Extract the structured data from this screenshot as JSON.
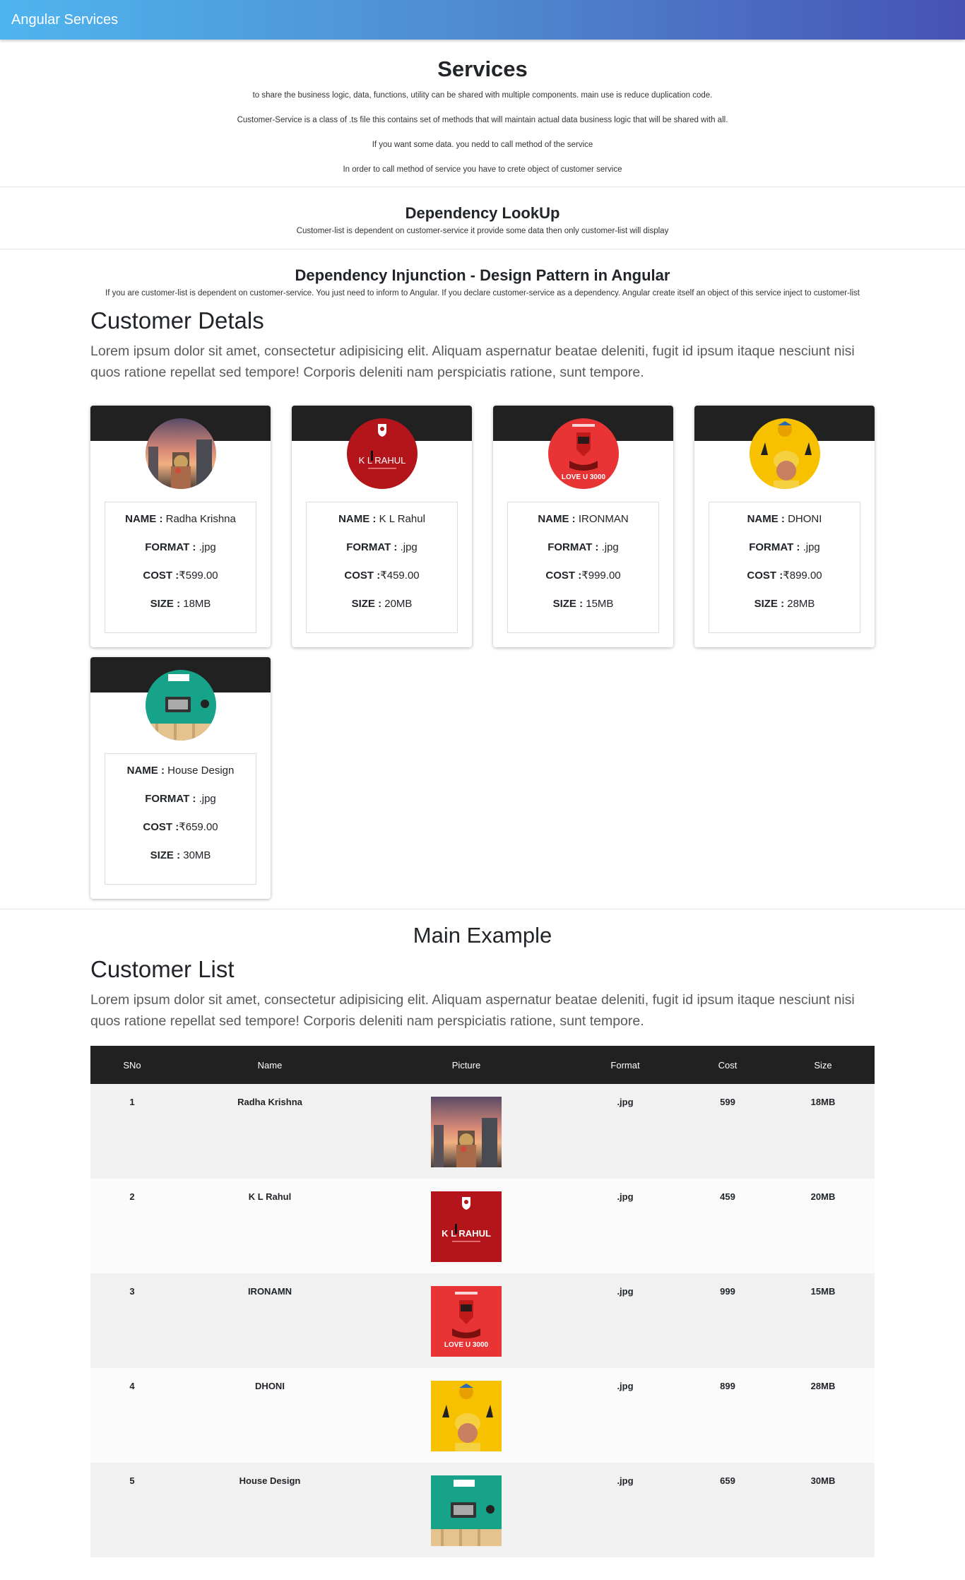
{
  "app": {
    "title": "Angular Services"
  },
  "services": {
    "heading": "Services",
    "lines": [
      "to share the business logic, data, functions, utility can be shared with multiple components. main use is reduce duplication code.",
      "Customer-Service is a class of .ts file this contains set of methods that will maintain actual data business logic that will be shared with all.",
      "If you want some data. you nedd to call method of the service",
      "In order to call method of service you have to crete object of customer service"
    ]
  },
  "lookup": {
    "heading": "Dependency LookUp",
    "text": "Customer-list is dependent on customer-service it provide some data then only customer-list will display"
  },
  "injection": {
    "heading": "Dependency Injunction - Design Pattern in Angular",
    "text": "If you are customer-list is dependent on customer-service. You just need to inform to Angular. If you declare customer-service as a dependency. Angular create itself an object of this service inject to customer-list"
  },
  "details": {
    "heading": "Customer Detals",
    "lead": "Lorem ipsum dolor sit amet, consectetur adipisicing elit. Aliquam aspernatur beatae deleniti, fugit id ipsum itaque nesciunt nisi quos ratione repellat sed tempore! Corporis deleniti nam perspiciatis ratione, sunt tempore.",
    "labels": {
      "name": "NAME :",
      "format": "FORMAT :",
      "cost": "COST :",
      "size": "SIZE :"
    },
    "cards": [
      {
        "name": "Radha Krishna",
        "format": ".jpg",
        "cost": "₹599.00",
        "size": "18MB",
        "image": "temple-sunset-image"
      },
      {
        "name": "K L Rahul",
        "format": ".jpg",
        "cost": "₹459.00",
        "size": "20MB",
        "image": "kl-rahul-poster-image"
      },
      {
        "name": "IRONMAN",
        "format": ".jpg",
        "cost": "₹999.00",
        "size": "15MB",
        "image": "ironman-love-poster-image"
      },
      {
        "name": "DHONI",
        "format": ".jpg",
        "cost": "₹899.00",
        "size": "28MB",
        "image": "dhoni-csk-poster-image"
      },
      {
        "name": "House Design",
        "format": ".jpg",
        "cost": "₹659.00",
        "size": "30MB",
        "image": "house-design-image"
      }
    ]
  },
  "main": {
    "heading": "Main Example",
    "list_heading": "Customer List",
    "lead": "Lorem ipsum dolor sit amet, consectetur adipisicing elit. Aliquam aspernatur beatae deleniti, fugit id ipsum itaque nesciunt nisi quos ratione repellat sed tempore! Corporis deleniti nam perspiciatis ratione, sunt tempore.",
    "table": {
      "headers": [
        "SNo",
        "Name",
        "Picture",
        "Format",
        "Cost",
        "Size"
      ],
      "rows": [
        {
          "sno": "1",
          "name": "Radha Krishna",
          "format": ".jpg",
          "cost": "599",
          "size": "18MB"
        },
        {
          "sno": "2",
          "name": "K L Rahul",
          "format": ".jpg",
          "cost": "459",
          "size": "20MB"
        },
        {
          "sno": "3",
          "name": "IRONAMN",
          "format": ".jpg",
          "cost": "999",
          "size": "15MB"
        },
        {
          "sno": "4",
          "name": "DHONI",
          "format": ".jpg",
          "cost": "899",
          "size": "28MB"
        },
        {
          "sno": "5",
          "name": "House Design",
          "format": ".jpg",
          "cost": "659",
          "size": "30MB"
        }
      ]
    }
  },
  "poster_text": {
    "kl_rahul": "K L RAHUL",
    "love": "LOVE U 3000"
  },
  "colors": {
    "header_gradient_start": "#4fb5ee",
    "header_gradient_end": "#4752b4",
    "card_header": "#212121",
    "table_header": "#212121"
  }
}
